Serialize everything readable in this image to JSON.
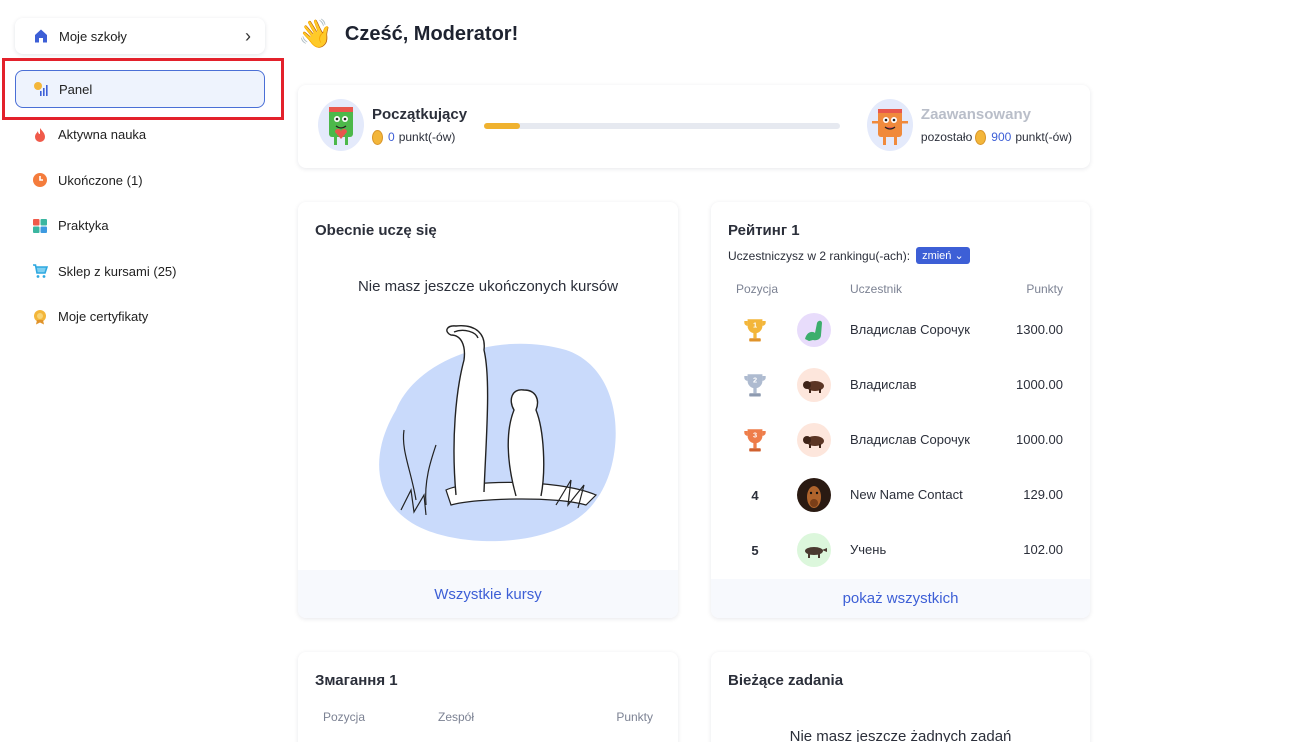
{
  "sidebar": {
    "school_button": {
      "label": "Moje szkoły",
      "icon": "home-icon"
    },
    "items": [
      {
        "label": "Panel",
        "icon": "panel-icon",
        "active": true
      },
      {
        "label": "Aktywna nauka",
        "icon": "flame-icon"
      },
      {
        "label": "Ukończone (1)",
        "icon": "clock-icon"
      },
      {
        "label": "Praktyka",
        "icon": "grid-icon"
      },
      {
        "label": "Sklep z kursami (25)",
        "icon": "cart-icon"
      },
      {
        "label": "Moje certyfikaty",
        "icon": "certificate-icon"
      }
    ]
  },
  "header": {
    "wave": "👋",
    "title": "Cześć, Moderator!"
  },
  "level": {
    "current_name": "Początkujący",
    "current_points": "0",
    "points_suffix": "punkt(-ów)",
    "progress": 0.1,
    "next_name": "Zaawansowany",
    "remaining_label": "pozostało",
    "remaining_points": "900",
    "remaining_suffix": "punkt(-ów)"
  },
  "courses": {
    "title": "Obecnie uczę się",
    "empty": "Nie masz jeszcze ukończonych kursów",
    "footer": "Wszystkie kursy"
  },
  "rating": {
    "title": "Рейтинг 1",
    "subtitle": "Uczestniczysz w 2 rankingu(-ach):",
    "change": "zmień",
    "headers": {
      "position": "Pozycja",
      "participant": "Uczestnik",
      "points": "Punkty"
    },
    "rows": [
      {
        "pos": "1",
        "name": "Владислав Сорочук",
        "points": "1300.00",
        "avatar": "dinosaur-avatar",
        "color": "#e8dcfb"
      },
      {
        "pos": "2",
        "name": "Владислав",
        "points": "1000.00",
        "avatar": "bison-avatar",
        "color": "#fde6dc"
      },
      {
        "pos": "3",
        "name": "Владислав Сорочук",
        "points": "1000.00",
        "avatar": "bison-avatar",
        "color": "#fde6dc"
      },
      {
        "pos": "4",
        "name": "New Name Contact",
        "points": "129.00",
        "avatar": "dog-photo-avatar",
        "color": "#3a2418"
      },
      {
        "pos": "5",
        "name": "Учень",
        "points": "102.00",
        "avatar": "animal-avatar",
        "color": "#dcf7dc"
      }
    ],
    "footer": "pokaż wszystkich"
  },
  "competition": {
    "title": "Змагання 1",
    "headers": {
      "position": "Pozycja",
      "team": "Zespół",
      "points": "Punkty"
    }
  },
  "tasks": {
    "title": "Bieżące zadania",
    "empty": "Nie masz jeszcze żadnych zadań"
  },
  "colors": {
    "accent": "#3d5fd6",
    "highlight": "#e3212b",
    "coin": "#f3b63a",
    "progress": "#f0b22f"
  }
}
